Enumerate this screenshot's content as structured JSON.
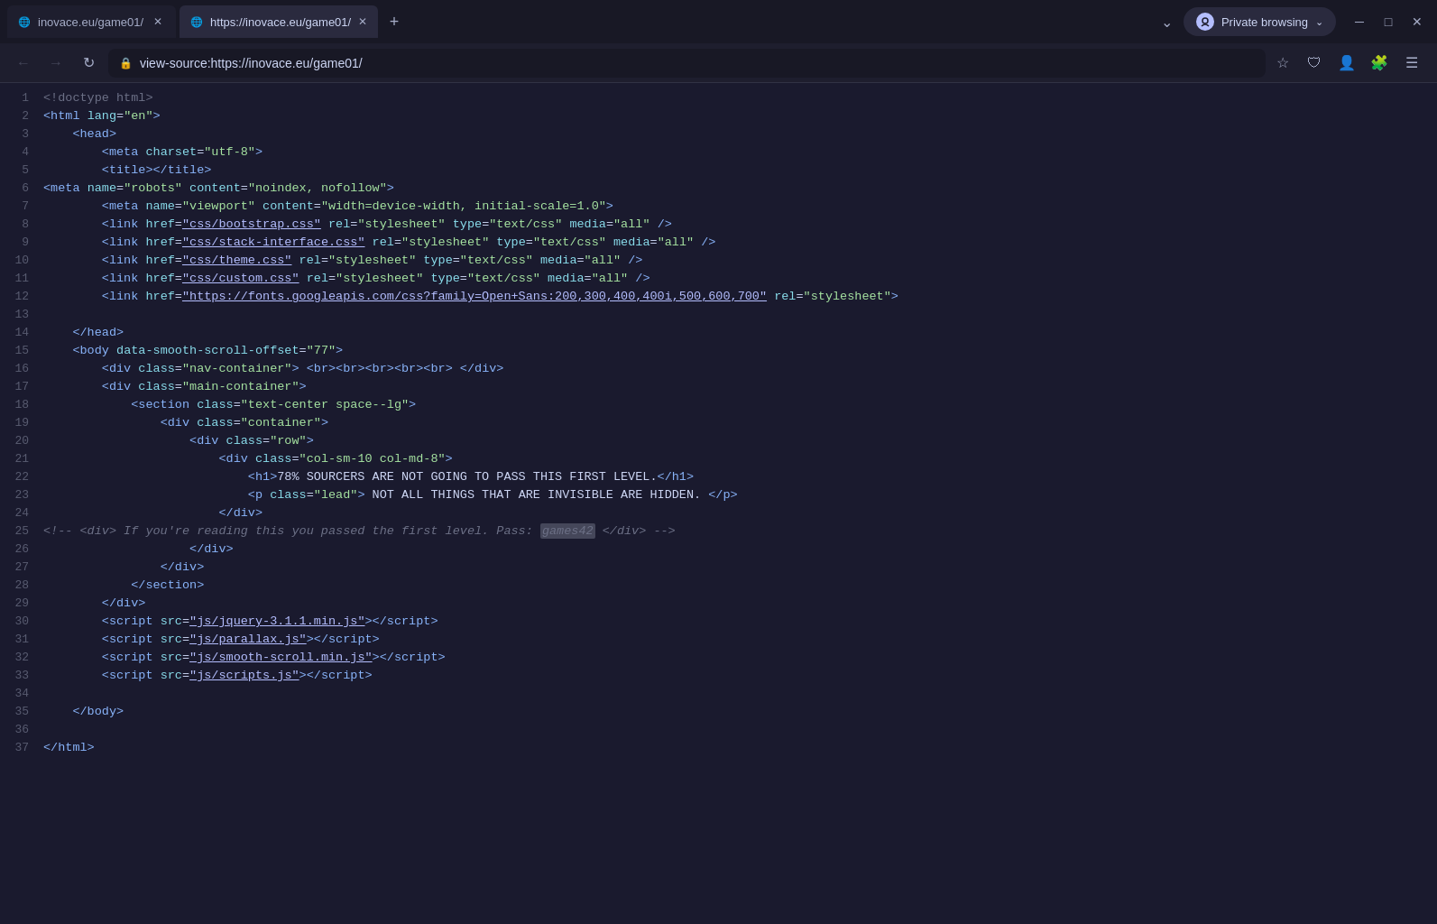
{
  "browser": {
    "tabs": [
      {
        "id": "tab1",
        "label": "inovace.eu/game01/",
        "active": false,
        "closable": true
      },
      {
        "id": "tab2",
        "label": "https://inovace.eu/game01/",
        "active": true,
        "closable": true
      }
    ],
    "tab_add_label": "+",
    "tab_overflow_label": "⌄",
    "private_browsing_label": "Private browsing",
    "nav": {
      "back_label": "←",
      "forward_label": "→",
      "reload_label": "↻",
      "address": "view-source:https://inovace.eu/game01/",
      "lock_icon": "🔒",
      "star_label": "☆"
    },
    "toolbar": {
      "shield_label": "🛡",
      "profile_label": "👤",
      "extensions_label": "🧩",
      "menu_label": "☰"
    },
    "window_controls": {
      "minimize": "─",
      "maximize": "□",
      "close": "✕"
    }
  },
  "source": {
    "lines": [
      {
        "n": 1,
        "html": "<span class='c-doctype'>&lt;!doctype html&gt;</span>"
      },
      {
        "n": 2,
        "html": "<span class='c-tag'>&lt;html</span> <span class='c-attr'>lang</span>=<span class='c-val'>\"en\"</span><span class='c-tag'>&gt;</span>"
      },
      {
        "n": 3,
        "html": "    <span class='c-tag'>&lt;head&gt;</span>"
      },
      {
        "n": 4,
        "html": "        <span class='c-tag'>&lt;meta</span> <span class='c-attr'>charset</span>=<span class='c-val'>\"utf-8\"</span><span class='c-tag'>&gt;</span>"
      },
      {
        "n": 5,
        "html": "        <span class='c-tag'>&lt;title&gt;&lt;/title&gt;</span>"
      },
      {
        "n": 6,
        "html": "<span class='c-tag'>&lt;meta</span> <span class='c-attr'>name</span>=<span class='c-val'>\"robots\"</span> <span class='c-attr'>content</span>=<span class='c-val'>\"noindex, nofollow\"</span><span class='c-tag'>&gt;</span>"
      },
      {
        "n": 7,
        "html": "        <span class='c-tag'>&lt;meta</span> <span class='c-attr'>name</span>=<span class='c-val'>\"viewport\"</span> <span class='c-attr'>content</span>=<span class='c-val'>\"width=device-width, initial-scale=1.0\"</span><span class='c-tag'>&gt;</span>"
      },
      {
        "n": 8,
        "html": "        <span class='c-tag'>&lt;link</span> <span class='c-attr'>href</span>=<span class='c-val-link'>\"css/bootstrap.css\"</span> <span class='c-attr'>rel</span>=<span class='c-val'>\"stylesheet\"</span> <span class='c-attr'>type</span>=<span class='c-val'>\"text/css\"</span> <span class='c-attr'>media</span>=<span class='c-val'>\"all\"</span> <span class='c-tag'>/&gt;</span>"
      },
      {
        "n": 9,
        "html": "        <span class='c-tag'>&lt;link</span> <span class='c-attr'>href</span>=<span class='c-val-link'>\"css/stack-interface.css\"</span> <span class='c-attr'>rel</span>=<span class='c-val'>\"stylesheet\"</span> <span class='c-attr'>type</span>=<span class='c-val'>\"text/css\"</span> <span class='c-attr'>media</span>=<span class='c-val'>\"all\"</span> <span class='c-tag'>/&gt;</span>"
      },
      {
        "n": 10,
        "html": "        <span class='c-tag'>&lt;link</span> <span class='c-attr'>href</span>=<span class='c-val-link'>\"css/theme.css\"</span> <span class='c-attr'>rel</span>=<span class='c-val'>\"stylesheet\"</span> <span class='c-attr'>type</span>=<span class='c-val'>\"text/css\"</span> <span class='c-attr'>media</span>=<span class='c-val'>\"all\"</span> <span class='c-tag'>/&gt;</span>"
      },
      {
        "n": 11,
        "html": "        <span class='c-tag'>&lt;link</span> <span class='c-attr'>href</span>=<span class='c-val-link'>\"css/custom.css\"</span> <span class='c-attr'>rel</span>=<span class='c-val'>\"stylesheet\"</span> <span class='c-attr'>type</span>=<span class='c-val'>\"text/css\"</span> <span class='c-attr'>media</span>=<span class='c-val'>\"all\"</span> <span class='c-tag'>/&gt;</span>"
      },
      {
        "n": 12,
        "html": "        <span class='c-tag'>&lt;link</span> <span class='c-attr'>href</span>=<span class='c-val-link'>\"https://fonts.googleapis.com/css?family=Open+Sans:200,300,400,400i,500,600,700\"</span> <span class='c-attr'>rel</span>=<span class='c-val'>\"stylesheet\"</span><span class='c-tag'>&gt;</span>"
      },
      {
        "n": 13,
        "html": ""
      },
      {
        "n": 14,
        "html": "    <span class='c-tag'>&lt;/head&gt;</span>"
      },
      {
        "n": 15,
        "html": "    <span class='c-tag'>&lt;body</span> <span class='c-attr'>data-smooth-scroll-offset</span>=<span class='c-val'>\"77\"</span><span class='c-tag'>&gt;</span>"
      },
      {
        "n": 16,
        "html": "        <span class='c-tag'>&lt;div</span> <span class='c-attr'>class</span>=<span class='c-val'>\"nav-container\"</span><span class='c-tag'>&gt;</span> <span class='c-tag'>&lt;br&gt;&lt;br&gt;&lt;br&gt;&lt;br&gt;&lt;br&gt;</span> <span class='c-tag'>&lt;/div&gt;</span>"
      },
      {
        "n": 17,
        "html": "        <span class='c-tag'>&lt;div</span> <span class='c-attr'>class</span>=<span class='c-val'>\"main-container\"</span><span class='c-tag'>&gt;</span>"
      },
      {
        "n": 18,
        "html": "            <span class='c-tag'>&lt;section</span> <span class='c-attr'>class</span>=<span class='c-val'>\"text-center space--lg\"</span><span class='c-tag'>&gt;</span>"
      },
      {
        "n": 19,
        "html": "                <span class='c-tag'>&lt;div</span> <span class='c-attr'>class</span>=<span class='c-val'>\"container\"</span><span class='c-tag'>&gt;</span>"
      },
      {
        "n": 20,
        "html": "                    <span class='c-tag'>&lt;div</span> <span class='c-attr'>class</span>=<span class='c-val'>\"row\"</span><span class='c-tag'>&gt;</span>"
      },
      {
        "n": 21,
        "html": "                        <span class='c-tag'>&lt;div</span> <span class='c-attr'>class</span>=<span class='c-val'>\"col-sm-10 col-md-8\"</span><span class='c-tag'>&gt;</span>"
      },
      {
        "n": 22,
        "html": "                            <span class='c-tag'>&lt;h1&gt;</span>78% SOURCERS ARE NOT GOING TO PASS THIS FIRST LEVEL.<span class='c-tag'>&lt;/h1&gt;</span>"
      },
      {
        "n": 23,
        "html": "                            <span class='c-tag'>&lt;p</span> <span class='c-attr'>class</span>=<span class='c-val'>\"lead\"</span><span class='c-tag'>&gt;</span> NOT ALL THINGS THAT ARE INVISIBLE ARE HIDDEN. <span class='c-tag'>&lt;/p&gt;</span>"
      },
      {
        "n": 24,
        "html": "                        <span class='c-tag'>&lt;/div&gt;</span>"
      },
      {
        "n": 25,
        "html": "<span class='c-comment'>&lt;!-- &lt;div&gt; If you're reading this you passed the first level. Pass: <span class='c-highlight'>games42</span> &lt;/div&gt; --&gt;</span>"
      },
      {
        "n": 26,
        "html": "                    <span class='c-tag'>&lt;/div&gt;</span>"
      },
      {
        "n": 27,
        "html": "                <span class='c-tag'>&lt;/div&gt;</span>"
      },
      {
        "n": 28,
        "html": "            <span class='c-tag'>&lt;/section&gt;</span>"
      },
      {
        "n": 29,
        "html": "        <span class='c-tag'>&lt;/div&gt;</span>"
      },
      {
        "n": 30,
        "html": "        <span class='c-tag'>&lt;script</span> <span class='c-attr'>src</span>=<span class='c-val-link'>\"js/jquery-3.1.1.min.js\"</span><span class='c-tag'>&gt;&lt;/script&gt;</span>"
      },
      {
        "n": 31,
        "html": "        <span class='c-tag'>&lt;script</span> <span class='c-attr'>src</span>=<span class='c-val-link'>\"js/parallax.js\"</span><span class='c-tag'>&gt;&lt;/script&gt;</span>"
      },
      {
        "n": 32,
        "html": "        <span class='c-tag'>&lt;script</span> <span class='c-attr'>src</span>=<span class='c-val-link'>\"js/smooth-scroll.min.js\"</span><span class='c-tag'>&gt;&lt;/script&gt;</span>"
      },
      {
        "n": 33,
        "html": "        <span class='c-tag'>&lt;script</span> <span class='c-attr'>src</span>=<span class='c-val-link'>\"js/scripts.js\"</span><span class='c-tag'>&gt;&lt;/script&gt;</span>"
      },
      {
        "n": 34,
        "html": ""
      },
      {
        "n": 35,
        "html": "    <span class='c-tag'>&lt;/body&gt;</span>"
      },
      {
        "n": 36,
        "html": ""
      },
      {
        "n": 37,
        "html": "<span class='c-tag'>&lt;/html&gt;</span>"
      }
    ]
  }
}
